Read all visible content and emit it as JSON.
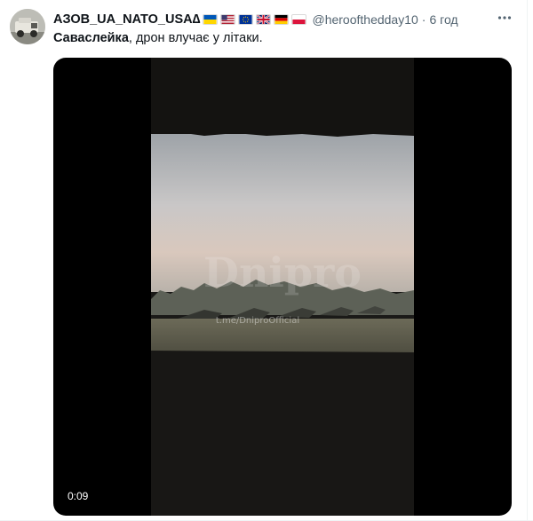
{
  "tweet": {
    "author": {
      "display_name": "АЗОВ_UA_NATO_USA∆",
      "handle": "@heroofthedday10",
      "flags": [
        "ukraine-flag-icon",
        "usa-flag-icon",
        "eu-flag-icon",
        "uk-flag-icon",
        "germany-flag-icon",
        "poland-flag-icon"
      ]
    },
    "separator": "·",
    "time": "6 год",
    "text": {
      "bold_part": "Саваслейка",
      "rest": ", дрон влучає у літаки."
    },
    "media": {
      "type": "video",
      "duration": "0:09",
      "watermark": "t.me/DniproOfficial"
    }
  },
  "colors": {
    "primary_text": "#0f1419",
    "secondary_text": "#536471",
    "divider": "#eff3f4"
  }
}
